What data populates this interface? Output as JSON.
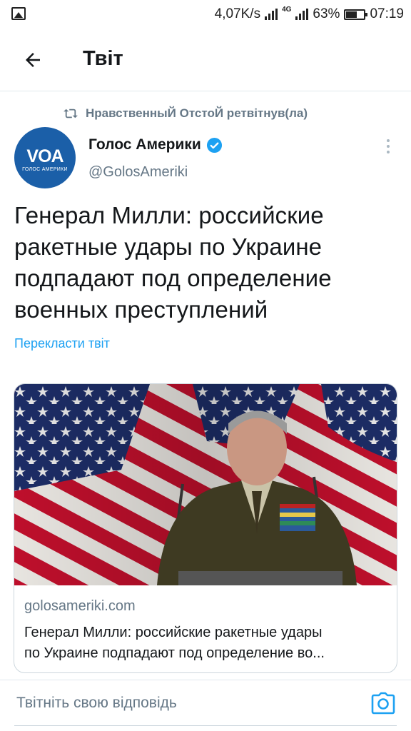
{
  "status_bar": {
    "net_speed": "4,07K/s",
    "network_type": "4G",
    "battery_percent": "63%",
    "battery_level": 0.63,
    "time": "07:19"
  },
  "header": {
    "title": "Твіт",
    "back_icon": "arrow-left-icon"
  },
  "tweet": {
    "retweet_line": "НравственныЙ ОтстоЙ ретвітнув(ла)",
    "author_name": "Голос Америки",
    "author_handle": "@GolosAmeriki",
    "avatar_logo": "VOA",
    "avatar_sub": "ГОЛОС АМЕРИКИ",
    "verified": true,
    "text": "Генерал Милли: российские ракетные удары по Украине подпадают под определение военных преступлений",
    "translate_label": "Перекласти твіт",
    "card": {
      "domain": "golosameriki.com",
      "title_line1": "Генерал Милли: российские ракетные удары",
      "title_line2": "по Украине подпадают под определение во..."
    }
  },
  "reply": {
    "placeholder": "Твітніть свою відповідь",
    "camera_icon": "camera-icon"
  },
  "colors": {
    "accent": "#1da1f2",
    "secondary_text": "#657786",
    "avatar_blue": "#1b5fa8"
  }
}
